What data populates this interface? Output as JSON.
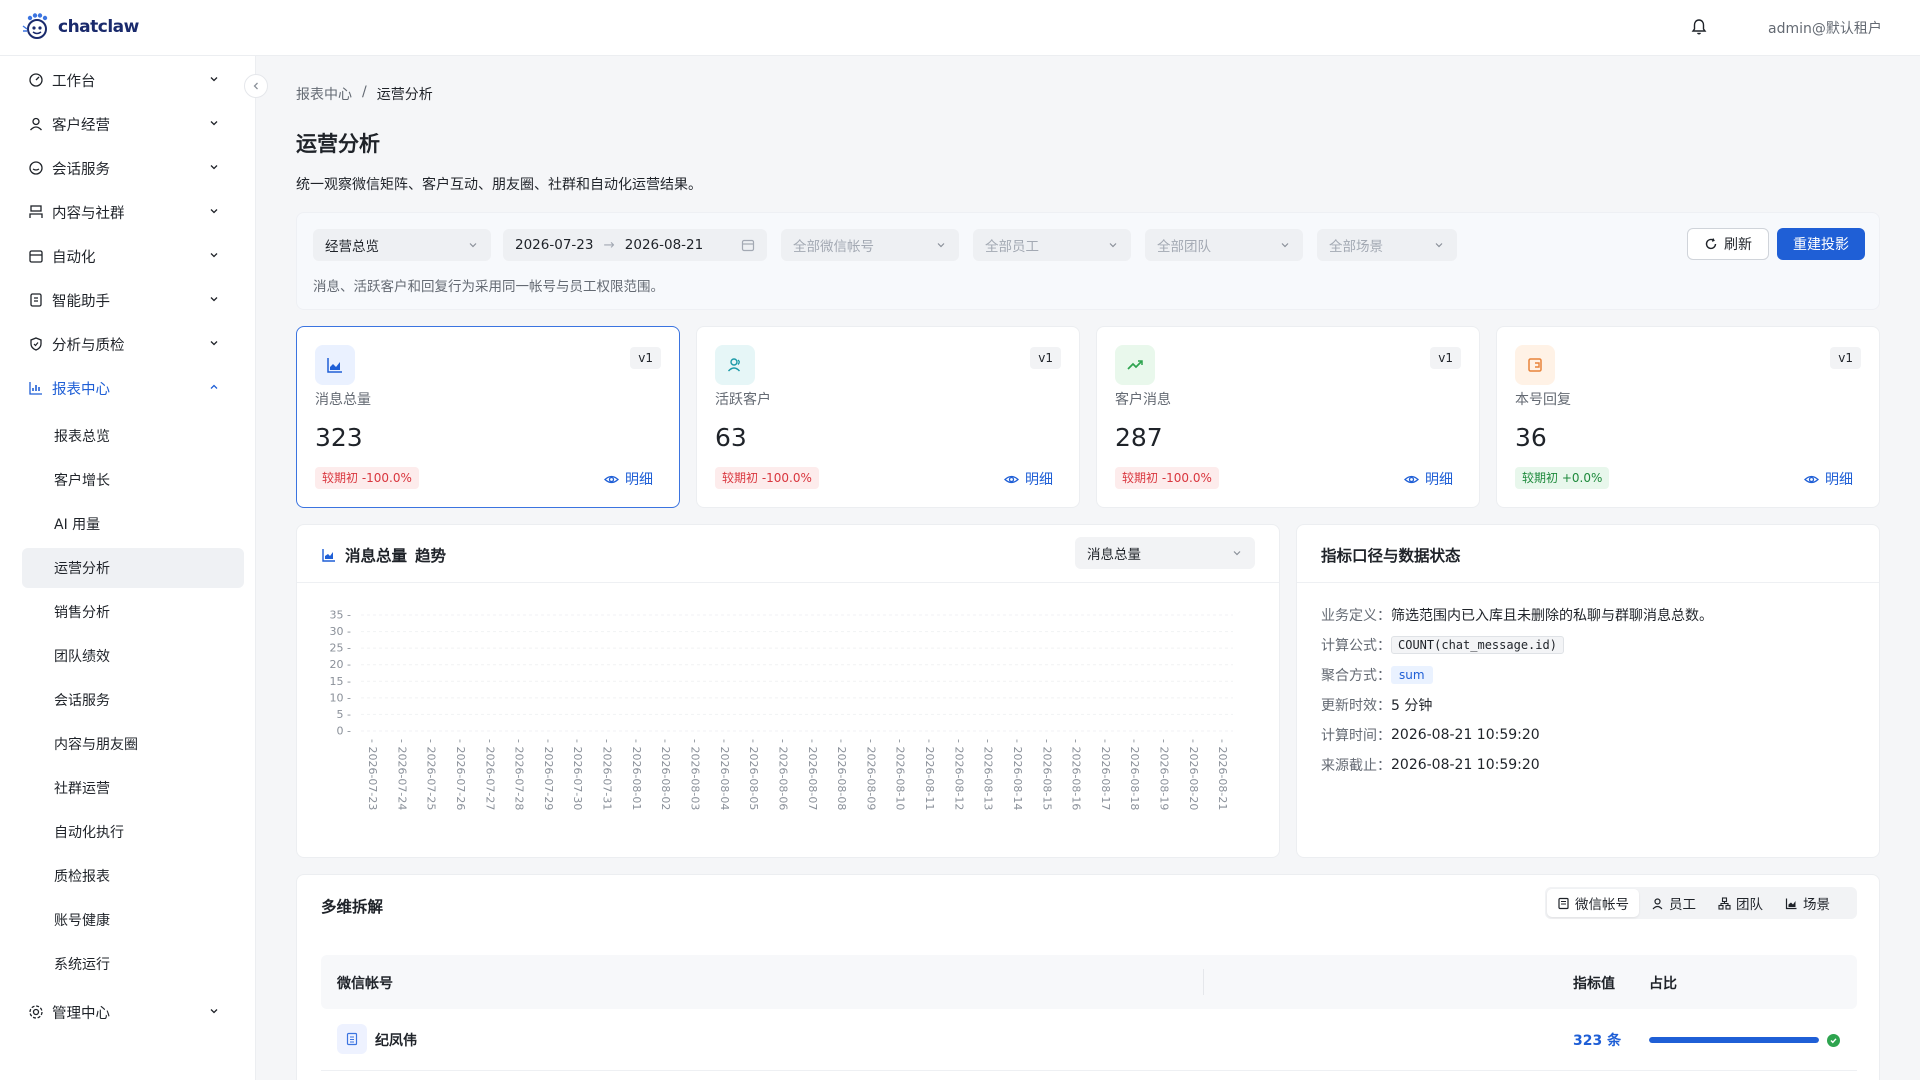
{
  "app": {
    "name": "chatclaw",
    "user": "admin@默认租户"
  },
  "sidebar": {
    "groups": [
      {
        "label": "工作台"
      },
      {
        "label": "客户经营"
      },
      {
        "label": "会话服务"
      },
      {
        "label": "内容与社群"
      },
      {
        "label": "自动化"
      },
      {
        "label": "智能助手"
      },
      {
        "label": "分析与质检"
      },
      {
        "label": "报表中心"
      },
      {
        "label": "管理中心"
      }
    ],
    "report_items": [
      "报表总览",
      "客户增长",
      "AI 用量",
      "运营分析",
      "销售分析",
      "团队绩效",
      "会话服务",
      "内容与朋友圈",
      "社群运营",
      "自动化执行",
      "质检报表",
      "账号健康",
      "系统运行"
    ]
  },
  "breadcrumb": {
    "parent": "报表中心",
    "sep": "/",
    "current": "运营分析"
  },
  "page": {
    "title": "运营分析",
    "desc": "统一观察微信矩阵、客户互动、朋友圈、社群和自动化运营结果。"
  },
  "filters": {
    "view": "经营总览",
    "date_start": "2026-07-23",
    "date_sep": "→",
    "date_end": "2026-08-21",
    "wechat_ph": "全部微信帐号",
    "staff_ph": "全部员工",
    "team_ph": "全部团队",
    "scene_ph": "全部场景",
    "note": "消息、活跃客户和回复行为采用同一帐号与员工权限范围。",
    "refresh": "刷新",
    "rebuild": "重建投影"
  },
  "kpis": [
    {
      "label": "消息总量",
      "value": "323",
      "ver": "v1",
      "change": "较期初 -100.0%",
      "detail": "明细",
      "icon": "bar-chart-icon"
    },
    {
      "label": "活跃客户",
      "value": "63",
      "ver": "v1",
      "change": "较期初 -100.0%",
      "detail": "明细",
      "icon": "users-icon"
    },
    {
      "label": "客户消息",
      "value": "287",
      "ver": "v1",
      "change": "较期初 -100.0%",
      "detail": "明细",
      "icon": "trend-up-icon"
    },
    {
      "label": "本号回复",
      "value": "36",
      "ver": "v1",
      "change": "较期初 +0.0%",
      "detail": "明细",
      "icon": "reply-icon"
    }
  ],
  "trend": {
    "title_prefix": "消息总量",
    "title_suffix": "趋势",
    "metric_select": "消息总量"
  },
  "chart_data": {
    "type": "line",
    "title": "消息总量 趋势",
    "ylim": [
      0,
      35
    ],
    "yticks": [
      0,
      5,
      10,
      15,
      20,
      25,
      30,
      35
    ],
    "categories": [
      "2026-07-23",
      "2026-07-24",
      "2026-07-25",
      "2026-07-26",
      "2026-07-27",
      "2026-07-28",
      "2026-07-29",
      "2026-07-30",
      "2026-07-31",
      "2026-08-01",
      "2026-08-02",
      "2026-08-03",
      "2026-08-04",
      "2026-08-05",
      "2026-08-06",
      "2026-08-07",
      "2026-08-08",
      "2026-08-09",
      "2026-08-10",
      "2026-08-11",
      "2026-08-12",
      "2026-08-13",
      "2026-08-14",
      "2026-08-15",
      "2026-08-16",
      "2026-08-17",
      "2026-08-18",
      "2026-08-19",
      "2026-08-20",
      "2026-08-21"
    ],
    "grid": true
  },
  "definition": {
    "title": "指标口径与数据状态",
    "rows": [
      {
        "k": "业务定义：",
        "v": "筛选范围内已入库且未删除的私聊与群聊消息总数。"
      },
      {
        "k": "计算公式：",
        "v": "COUNT(chat_message.id)"
      },
      {
        "k": "聚合方式：",
        "v": "sum"
      },
      {
        "k": "更新时效：",
        "v": "5 分钟"
      },
      {
        "k": "计算时间：",
        "v": "2026-08-21 10:59:20"
      },
      {
        "k": "来源截止：",
        "v": "2026-08-21 10:59:20"
      }
    ]
  },
  "breakdown": {
    "title": "多维拆解",
    "tabs": [
      "微信帐号",
      "员工",
      "团队",
      "场景"
    ],
    "headers": {
      "dim": "微信帐号",
      "value": "指标值",
      "share": "占比"
    },
    "rows": [
      {
        "name": "纪凤伟",
        "value": "323 条",
        "share": 1.0
      }
    ]
  },
  "colors": {
    "accent": "#1f5fd6",
    "neg": "#d9363e",
    "pos": "#1e8a3c"
  }
}
